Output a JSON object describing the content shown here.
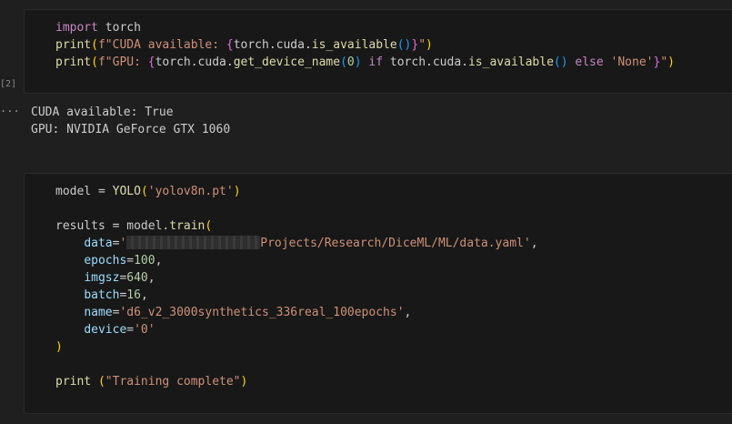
{
  "cell1": {
    "execution_count": "[2]",
    "lines": [
      [
        {
          "t": "import",
          "c": "kw"
        },
        {
          "t": " torch",
          "c": "txt"
        }
      ],
      [
        {
          "t": "print",
          "c": "fn"
        },
        {
          "t": "(",
          "c": "br1"
        },
        {
          "t": "f\"CUDA available: ",
          "c": "str"
        },
        {
          "t": "{",
          "c": "br2"
        },
        {
          "t": "torch.cuda.",
          "c": "txt"
        },
        {
          "t": "is_available",
          "c": "fn"
        },
        {
          "t": "()",
          "c": "br3"
        },
        {
          "t": "}",
          "c": "br2"
        },
        {
          "t": "\"",
          "c": "str"
        },
        {
          "t": ")",
          "c": "br1"
        }
      ],
      [
        {
          "t": "print",
          "c": "fn"
        },
        {
          "t": "(",
          "c": "br1"
        },
        {
          "t": "f\"GPU: ",
          "c": "str"
        },
        {
          "t": "{",
          "c": "br2"
        },
        {
          "t": "torch.cuda.",
          "c": "txt"
        },
        {
          "t": "get_device_name",
          "c": "fn"
        },
        {
          "t": "(",
          "c": "br3"
        },
        {
          "t": "0",
          "c": "num"
        },
        {
          "t": ")",
          "c": "br3"
        },
        {
          "t": " ",
          "c": "txt"
        },
        {
          "t": "if",
          "c": "kw"
        },
        {
          "t": " torch.cuda.",
          "c": "txt"
        },
        {
          "t": "is_available",
          "c": "fn"
        },
        {
          "t": "()",
          "c": "br3"
        },
        {
          "t": " ",
          "c": "txt"
        },
        {
          "t": "else",
          "c": "kw"
        },
        {
          "t": " ",
          "c": "txt"
        },
        {
          "t": "'None'",
          "c": "str"
        },
        {
          "t": "}",
          "c": "br2"
        },
        {
          "t": "\"",
          "c": "str"
        },
        {
          "t": ")",
          "c": "br1"
        }
      ]
    ]
  },
  "output": {
    "marker": "...",
    "lines": [
      "CUDA available: True",
      "GPU: NVIDIA GeForce GTX 1060"
    ]
  },
  "cell2": {
    "lines": [
      [
        {
          "t": "model = ",
          "c": "txt"
        },
        {
          "t": "YOLO",
          "c": "fn"
        },
        {
          "t": "(",
          "c": "br1"
        },
        {
          "t": "'yolov8n.pt'",
          "c": "str"
        },
        {
          "t": ")",
          "c": "br1"
        }
      ],
      [],
      [
        {
          "t": "results = model.",
          "c": "txt"
        },
        {
          "t": "train",
          "c": "fn"
        },
        {
          "t": "(",
          "c": "br1"
        }
      ],
      [
        {
          "t": "    ",
          "c": "txt"
        },
        {
          "t": "data",
          "c": "prm"
        },
        {
          "t": "=",
          "c": "txt"
        },
        {
          "t": "'",
          "c": "str"
        },
        {
          "t": "",
          "c": "redact"
        },
        {
          "t": "Projects/Research/DiceML/ML/data.yaml'",
          "c": "str"
        },
        {
          "t": ",",
          "c": "txt"
        }
      ],
      [
        {
          "t": "    ",
          "c": "txt"
        },
        {
          "t": "epochs",
          "c": "prm"
        },
        {
          "t": "=",
          "c": "txt"
        },
        {
          "t": "100",
          "c": "num"
        },
        {
          "t": ",",
          "c": "txt"
        }
      ],
      [
        {
          "t": "    ",
          "c": "txt"
        },
        {
          "t": "imgsz",
          "c": "prm"
        },
        {
          "t": "=",
          "c": "txt"
        },
        {
          "t": "640",
          "c": "num"
        },
        {
          "t": ",",
          "c": "txt"
        }
      ],
      [
        {
          "t": "    ",
          "c": "txt"
        },
        {
          "t": "batch",
          "c": "prm"
        },
        {
          "t": "=",
          "c": "txt"
        },
        {
          "t": "16",
          "c": "num"
        },
        {
          "t": ",",
          "c": "txt"
        }
      ],
      [
        {
          "t": "    ",
          "c": "txt"
        },
        {
          "t": "name",
          "c": "prm"
        },
        {
          "t": "=",
          "c": "txt"
        },
        {
          "t": "'d6_v2_3000synthetics_336real_100epochs'",
          "c": "str"
        },
        {
          "t": ",",
          "c": "txt"
        }
      ],
      [
        {
          "t": "    ",
          "c": "txt"
        },
        {
          "t": "device",
          "c": "prm"
        },
        {
          "t": "=",
          "c": "txt"
        },
        {
          "t": "'0'",
          "c": "str"
        }
      ],
      [
        {
          "t": ")",
          "c": "br1"
        }
      ],
      [],
      [
        {
          "t": "print",
          "c": "fn"
        },
        {
          "t": " ",
          "c": "txt"
        },
        {
          "t": "(",
          "c": "br1"
        },
        {
          "t": "\"Training complete\"",
          "c": "str"
        },
        {
          "t": ")",
          "c": "br1"
        }
      ]
    ]
  }
}
